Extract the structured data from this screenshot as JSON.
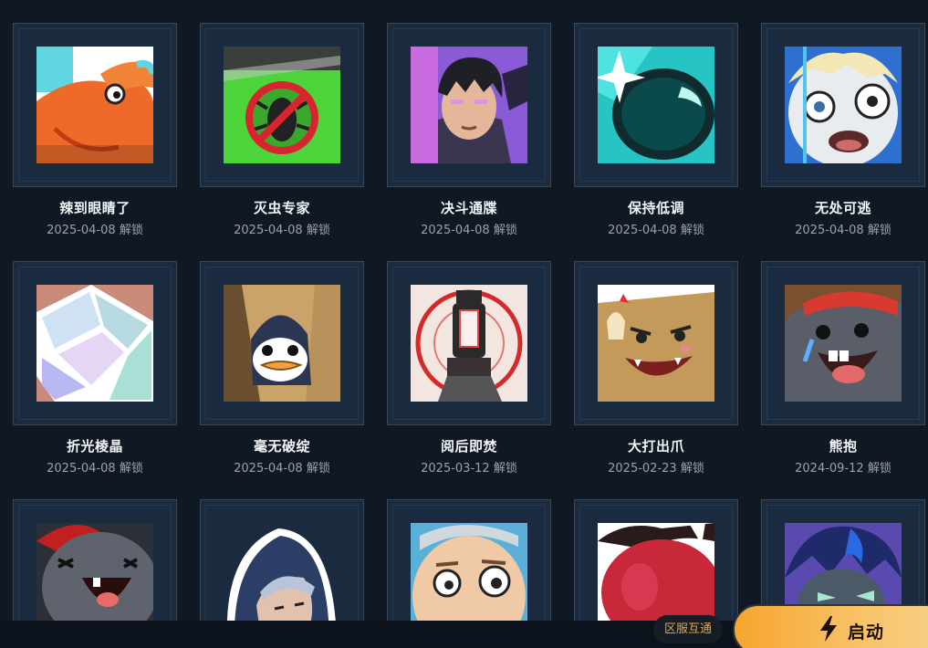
{
  "stickers": [
    {
      "name": "辣到眼睛了",
      "date": "2025-04-08",
      "suffix": "解锁",
      "icon": "red-dragon-spicy-art"
    },
    {
      "name": "灭虫专家",
      "date": "2025-04-08",
      "suffix": "解锁",
      "icon": "no-bug-sign-art"
    },
    {
      "name": "决斗通牒",
      "date": "2025-04-08",
      "suffix": "解锁",
      "icon": "duelist-portrait-art"
    },
    {
      "name": "保持低调",
      "date": "2025-04-08",
      "suffix": "解锁",
      "icon": "dark-visor-art"
    },
    {
      "name": "无处可逃",
      "date": "2025-04-08",
      "suffix": "解锁",
      "icon": "scared-face-art"
    },
    {
      "name": "折光棱晶",
      "date": "2025-04-08",
      "suffix": "解锁",
      "icon": "prism-glass-art"
    },
    {
      "name": "毫无破绽",
      "date": "2025-04-08",
      "suffix": "解锁",
      "icon": "penguin-hiding-art"
    },
    {
      "name": "阅后即焚",
      "date": "2025-03-12",
      "suffix": "解锁",
      "icon": "burning-lamp-art"
    },
    {
      "name": "大打出爪",
      "date": "2025-02-23",
      "suffix": "解锁",
      "icon": "angry-cat-art"
    },
    {
      "name": "熊抱",
      "date": "2024-09-12",
      "suffix": "解锁",
      "icon": "crying-bear-art"
    },
    {
      "name": "",
      "date": "",
      "suffix": "",
      "icon": "laughing-creature-art"
    },
    {
      "name": "",
      "date": "",
      "suffix": "",
      "icon": "hooded-figure-art"
    },
    {
      "name": "",
      "date": "",
      "suffix": "",
      "icon": "worried-face-art"
    },
    {
      "name": "",
      "date": "",
      "suffix": "",
      "icon": "red-blob-art"
    },
    {
      "name": "",
      "date": "",
      "suffix": "",
      "icon": "blue-hair-character-art"
    }
  ],
  "footer": {
    "region_label": "区服互通",
    "launch_label": "启动",
    "launch_icon": "lightning-bolt-icon"
  },
  "colors": {
    "background": "#0f1823",
    "card_inner": "#1a2b3f",
    "launch_button": "#f6a52f",
    "region_text": "#e8a34a"
  }
}
